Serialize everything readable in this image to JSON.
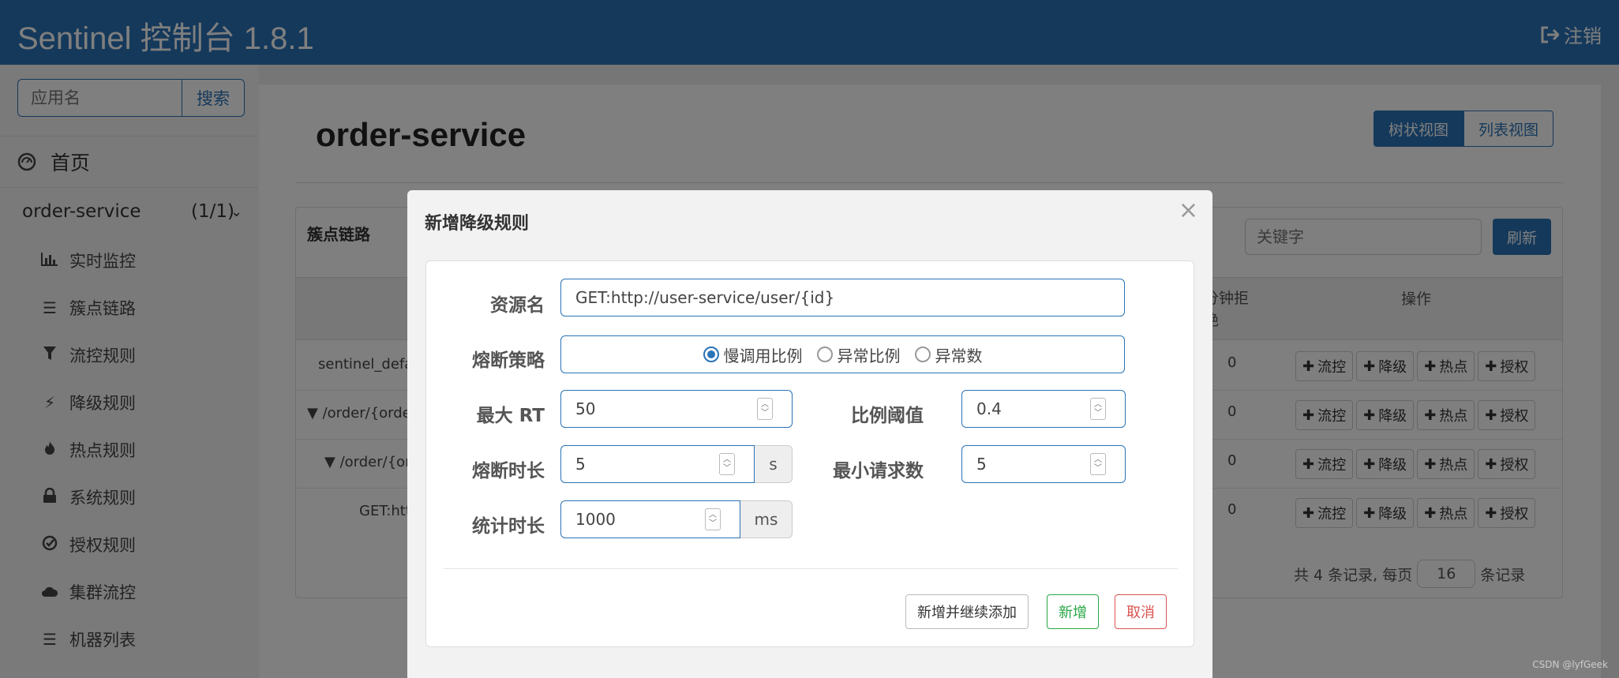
{
  "header": {
    "title": "Sentinel 控制台 1.8.1",
    "logout_label": "注销"
  },
  "sidebar": {
    "search_placeholder": "应用名",
    "search_button": "搜索",
    "home_label": "首页",
    "app": {
      "name": "order-service",
      "count": "(1/1)"
    },
    "items": [
      {
        "label": "实时监控",
        "icon": "bar-chart-icon"
      },
      {
        "label": "簇点链路",
        "icon": "list-icon"
      },
      {
        "label": "流控规则",
        "icon": "filter-icon"
      },
      {
        "label": "降级规则",
        "icon": "bolt-icon"
      },
      {
        "label": "热点规则",
        "icon": "fire-icon"
      },
      {
        "label": "系统规则",
        "icon": "lock-icon"
      },
      {
        "label": "授权规则",
        "icon": "check-circle-icon"
      },
      {
        "label": "集群流控",
        "icon": "cloud-icon"
      },
      {
        "label": "机器列表",
        "icon": "list-icon"
      }
    ]
  },
  "main": {
    "page_title": "order-service",
    "view_tree": "树状视图",
    "view_list": "列表视图",
    "panel_title": "簇点链路",
    "keyword_placeholder": "关键字",
    "refresh_button": "刷新",
    "columns": {
      "block_header": "分钟拒\n绝",
      "op_header": "操作"
    },
    "rows": [
      {
        "resource": "sentinel_defa",
        "rejected": "0"
      },
      {
        "resource": "▼ /order/{order",
        "rejected": "0"
      },
      {
        "resource": "▼ /order/{ord",
        "rejected": "0"
      },
      {
        "resource": "GET:htt",
        "rejected": "0"
      }
    ],
    "op_buttons": {
      "flow": "流控",
      "degrade": "降级",
      "hot": "热点",
      "auth": "授权"
    },
    "pager": {
      "prefix": "共 4 条记录, 每页",
      "page_size": "16",
      "suffix": "条记录"
    }
  },
  "modal": {
    "title": "新增降级规则",
    "close": "×",
    "resource_label": "资源名",
    "resource_value": "GET:http://user-service/user/{id}",
    "strategy_label": "熔断策略",
    "strategy_options": [
      "慢调用比例",
      "异常比例",
      "异常数"
    ],
    "max_rt_label": "最大 RT",
    "max_rt_value": "50",
    "ratio_label": "比例阈值",
    "ratio_value": "0.4",
    "duration_label": "熔断时长",
    "duration_value": "5",
    "duration_unit": "s",
    "min_req_label": "最小请求数",
    "min_req_value": "5",
    "stat_label": "统计时长",
    "stat_value": "1000",
    "stat_unit": "ms",
    "btn_add_continue": "新增并继续添加",
    "btn_add": "新增",
    "btn_cancel": "取消"
  },
  "watermark": "CSDN @lyfGeek"
}
